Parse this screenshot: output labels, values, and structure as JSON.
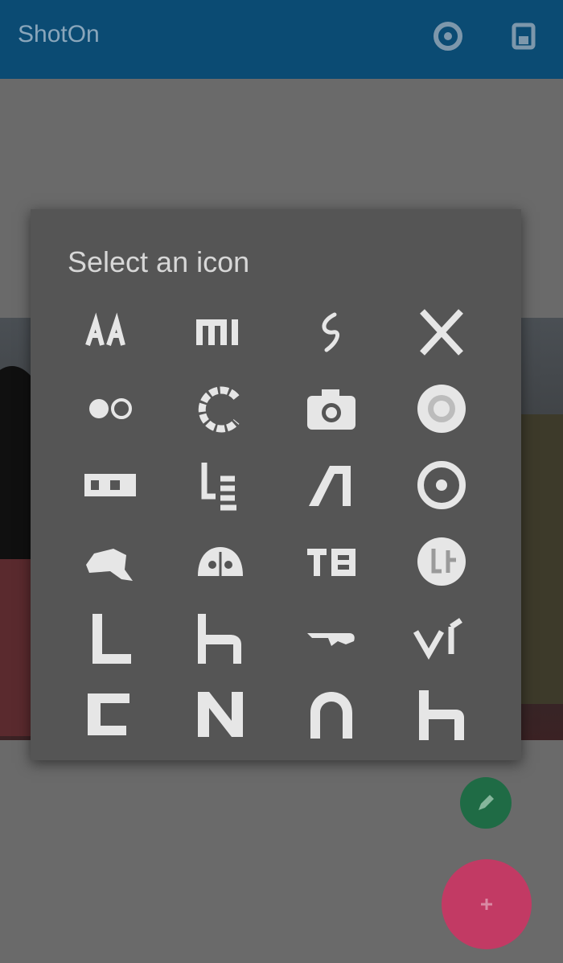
{
  "app": {
    "title": "ShotOn"
  },
  "toolbar": {
    "actions": [
      {
        "icon": "settings-icon"
      },
      {
        "icon": "save-icon"
      }
    ]
  },
  "dialog": {
    "title": "Select an icon",
    "icons": [
      "asus-icon",
      "mi-icon",
      "swirl-icon",
      "x-icon",
      "toggle-dots-icon",
      "circle-arc-icon",
      "camera-icon",
      "shutter-icon",
      "badge-rect-icon",
      "le-icon",
      "slash-a-icon",
      "target-ring-icon",
      "horse-icon",
      "cat-face-icon",
      "yu-icon",
      "globe-logo-icon",
      "l-letter-icon",
      "h-letter-icon",
      "wing-icon",
      "vi-letters-icon",
      "c-block-icon",
      "n-letter-icon",
      "arch-icon",
      "h-block-icon"
    ]
  },
  "fabs": {
    "edit_icon": "pencil-icon",
    "main_icon": "plus-icon"
  },
  "colors": {
    "appbar": "#0b4b73",
    "dialog": "#555555",
    "scrim": "#6a6a6a",
    "fab_small": "#1f6b45",
    "fab_main": "#c23a64",
    "icon": "#e6e6e6"
  }
}
